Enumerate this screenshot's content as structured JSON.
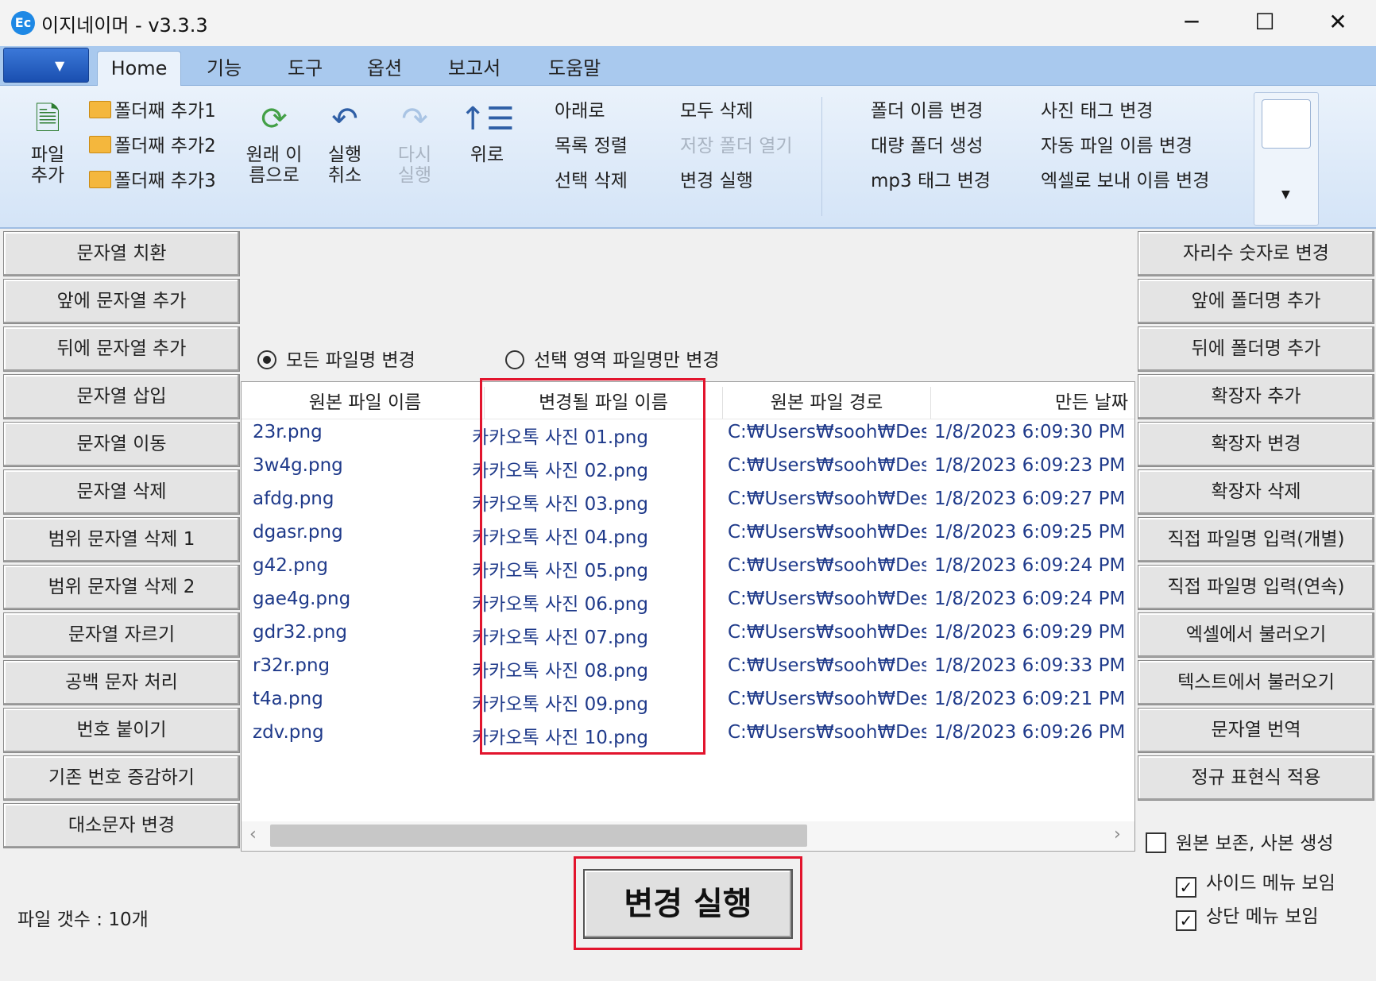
{
  "window": {
    "title": "이지네이머 - v3.3.3",
    "icon": "Ec",
    "minimize": "─",
    "maximize": "☐",
    "close": "✕"
  },
  "menu": {
    "tabs": [
      "Home",
      "기능",
      "도구",
      "옵션",
      "보고서",
      "도움말"
    ]
  },
  "ribbon": {
    "add_file": [
      "파일",
      "추가"
    ],
    "add_folder": [
      "폴더째 추가1",
      "폴더째 추가2",
      "폴더째 추가3"
    ],
    "restore_original": [
      "원래 이",
      "름으로"
    ],
    "undo": [
      "실행",
      "취소"
    ],
    "redo": [
      "다시",
      "실행"
    ],
    "move_up": "위로",
    "col3": [
      "아래로",
      "목록 정렬",
      "선택 삭제"
    ],
    "col4": [
      "모두 삭제",
      "저장 폴더 열기",
      "변경 실행"
    ],
    "col5": [
      "폴더 이름 변경",
      "대량 폴더 생성",
      "mp3 태그 변경"
    ],
    "col6": [
      "사진 태그 변경",
      "자동 파일 이름 변경",
      "엑셀로 보내 이름 변경"
    ]
  },
  "left_buttons": [
    "문자열 치환",
    "앞에 문자열 추가",
    "뒤에 문자열 추가",
    "문자열 삽입",
    "문자열 이동",
    "문자열 삭제",
    "범위 문자열 삭제 1",
    "범위 문자열 삭제 2",
    "문자열 자르기",
    "공백 문자 처리",
    "번호 붙이기",
    "기존 번호 증감하기",
    "대소문자 변경"
  ],
  "right_buttons": [
    "자리수 숫자로 변경",
    "앞에 폴더명 추가",
    "뒤에 폴더명 추가",
    "확장자 추가",
    "확장자 변경",
    "확장자 삭제",
    "직접 파일명 입력(개별)",
    "직접 파일명 입력(연속)",
    "엑셀에서 불러오기",
    "텍스트에서 불러오기",
    "문자열 번역",
    "정규 표현식 적용"
  ],
  "radios": {
    "all": "모든 파일명 변경",
    "selected": "선택 영역 파일명만 변경",
    "checked": "all"
  },
  "table": {
    "columns": [
      "원본 파일 이름",
      "변경될 파일 이름",
      "원본 파일 경로",
      "만든 날짜"
    ],
    "rows": [
      [
        "23r.png",
        "카카오톡 사진 01.png",
        "C:₩Users₩sooh₩Desk",
        "1/8/2023 6:09:30 PM"
      ],
      [
        "3w4g.png",
        "카카오톡 사진 02.png",
        "C:₩Users₩sooh₩Desk",
        "1/8/2023 6:09:23 PM"
      ],
      [
        "afdg.png",
        "카카오톡 사진 03.png",
        "C:₩Users₩sooh₩Desk",
        "1/8/2023 6:09:27 PM"
      ],
      [
        "dgasr.png",
        "카카오톡 사진 04.png",
        "C:₩Users₩sooh₩Desk",
        "1/8/2023 6:09:25 PM"
      ],
      [
        "g42.png",
        "카카오톡 사진 05.png",
        "C:₩Users₩sooh₩Desk",
        "1/8/2023 6:09:24 PM"
      ],
      [
        "gae4g.png",
        "카카오톡 사진 06.png",
        "C:₩Users₩sooh₩Desk",
        "1/8/2023 6:09:24 PM"
      ],
      [
        "gdr32.png",
        "카카오톡 사진 07.png",
        "C:₩Users₩sooh₩Desk",
        "1/8/2023 6:09:29 PM"
      ],
      [
        "r32r.png",
        "카카오톡 사진 08.png",
        "C:₩Users₩sooh₩Desk",
        "1/8/2023 6:09:33 PM"
      ],
      [
        "t4a.png",
        "카카오톡 사진 09.png",
        "C:₩Users₩sooh₩Desk",
        "1/8/2023 6:09:21 PM"
      ],
      [
        "zdv.png",
        "카카오톡 사진 10.png",
        "C:₩Users₩sooh₩Desk",
        "1/8/2023 6:09:26 PM"
      ]
    ]
  },
  "scroll_arrows": {
    "left": "‹",
    "right": "›"
  },
  "execute_button": "변경 실행",
  "file_count": "파일 갯수 : 10개",
  "options": {
    "keep_original": "원본 보존, 사본 생성",
    "keep_original_checked": false,
    "show_side_menu": "사이드 메뉴 보임",
    "show_side_menu_checked": true,
    "show_top_menu": "상단 메뉴 보임",
    "show_top_menu_checked": true
  },
  "colors": {
    "highlight": "#e2142d",
    "ribbon": "#d4e4f7",
    "menubar": "#a9c9ee",
    "list_text": "#1f3a8a"
  }
}
